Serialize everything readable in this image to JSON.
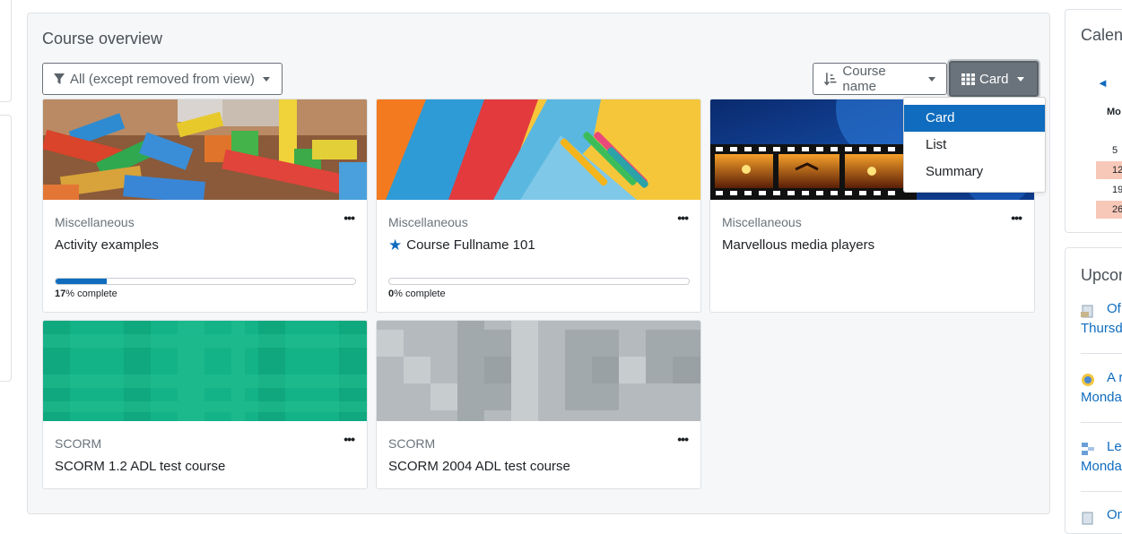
{
  "overview": {
    "title": "Course overview",
    "filter_label": "All (except removed from view)",
    "sort_label": "Course name",
    "view_label": "Card",
    "view_options": [
      "Card",
      "List",
      "Summary"
    ],
    "selected_view": "Card"
  },
  "courses": [
    {
      "category": "Miscellaneous",
      "name": "Activity examples",
      "starred": false,
      "progress": 17,
      "progress_suffix": "% complete",
      "image": "wooden-blocks"
    },
    {
      "category": "Miscellaneous",
      "name": "Course Fullname 101",
      "starred": true,
      "progress": 0,
      "progress_suffix": "% complete",
      "image": "pencils-notebook"
    },
    {
      "category": "Miscellaneous",
      "name": "Marvellous media players",
      "starred": false,
      "image": "film-strip"
    },
    {
      "category": "SCORM",
      "name": "SCORM 1.2 ADL test course",
      "starred": false,
      "image": "green-pattern"
    },
    {
      "category": "SCORM",
      "name": "SCORM 2004 ADL test course",
      "starred": false,
      "image": "grey-pattern"
    }
  ],
  "calendar": {
    "title": "Calendar",
    "prev_icon": "arrow-left-icon",
    "day_header": "Mo",
    "days": [
      "5",
      "12",
      "19",
      "26"
    ]
  },
  "upcoming": {
    "title": "Upcoming",
    "events": [
      {
        "title": "Of",
        "day": "Thursd",
        "icon": "document-icon"
      },
      {
        "title": "A r",
        "day": "Monda",
        "icon": "forum-icon"
      },
      {
        "title": "Les",
        "day": "Monda",
        "icon": "lesson-icon"
      },
      {
        "title": "On",
        "day": "",
        "icon": "document-icon"
      }
    ]
  },
  "colors": {
    "accent": "#0f6cbf",
    "view_button": "#6a737b",
    "highlight_day": "#f7c8b8"
  }
}
